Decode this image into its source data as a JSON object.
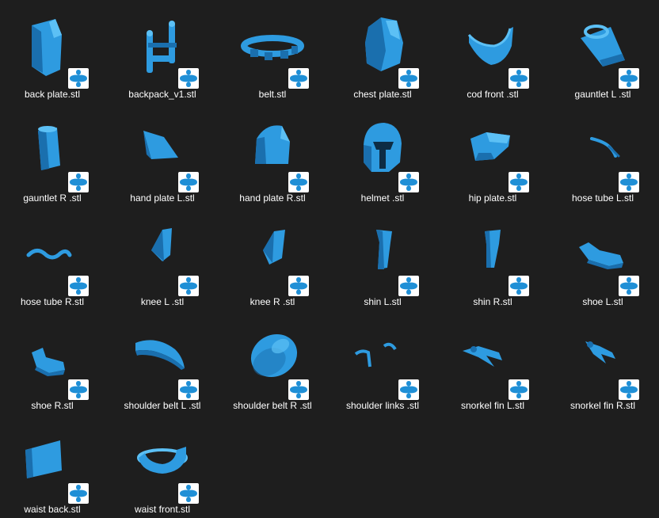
{
  "colors": {
    "background": "#1e1e1e",
    "model": "#2e9be0",
    "model_shade": "#1a6fae",
    "model_light": "#5cc0f5",
    "badge_icon": "#1f8fd6",
    "badge_bg": "#ffffff",
    "label": "#ffffff"
  },
  "badge_icon": "3d-viewer-app-icon",
  "files": [
    {
      "name": "back plate.stl",
      "icon": "back-plate-model-icon"
    },
    {
      "name": "backpack_v1.stl",
      "icon": "backpack-model-icon"
    },
    {
      "name": "belt.stl",
      "icon": "belt-model-icon"
    },
    {
      "name": "chest plate.stl",
      "icon": "chest-plate-model-icon"
    },
    {
      "name": "cod front .stl",
      "icon": "cod-front-model-icon"
    },
    {
      "name": "gauntlet L .stl",
      "icon": "gauntlet-left-model-icon"
    },
    {
      "name": "gauntlet R .stl",
      "icon": "gauntlet-right-model-icon"
    },
    {
      "name": "hand plate L.stl",
      "icon": "hand-plate-left-model-icon"
    },
    {
      "name": "hand plate R.stl",
      "icon": "hand-plate-right-model-icon"
    },
    {
      "name": "helmet .stl",
      "icon": "helmet-model-icon"
    },
    {
      "name": "hip plate.stl",
      "icon": "hip-plate-model-icon"
    },
    {
      "name": "hose tube L.stl",
      "icon": "hose-tube-left-model-icon"
    },
    {
      "name": "hose tube R.stl",
      "icon": "hose-tube-right-model-icon"
    },
    {
      "name": "knee L .stl",
      "icon": "knee-left-model-icon"
    },
    {
      "name": "knee R .stl",
      "icon": "knee-right-model-icon"
    },
    {
      "name": "shin L.stl",
      "icon": "shin-left-model-icon"
    },
    {
      "name": "shin R.stl",
      "icon": "shin-right-model-icon"
    },
    {
      "name": "shoe L.stl",
      "icon": "shoe-left-model-icon"
    },
    {
      "name": "shoe R.stl",
      "icon": "shoe-right-model-icon"
    },
    {
      "name": "shoulder belt L .stl",
      "icon": "shoulder-belt-left-model-icon"
    },
    {
      "name": "shoulder belt R .stl",
      "icon": "shoulder-belt-right-model-icon"
    },
    {
      "name": "shoulder links .stl",
      "icon": "shoulder-links-model-icon"
    },
    {
      "name": "snorkel fin L.stl",
      "icon": "snorkel-fin-left-model-icon"
    },
    {
      "name": "snorkel fin R.stl",
      "icon": "snorkel-fin-right-model-icon"
    },
    {
      "name": "waist back.stl",
      "icon": "waist-back-model-icon"
    },
    {
      "name": "waist front.stl",
      "icon": "waist-front-model-icon"
    }
  ]
}
